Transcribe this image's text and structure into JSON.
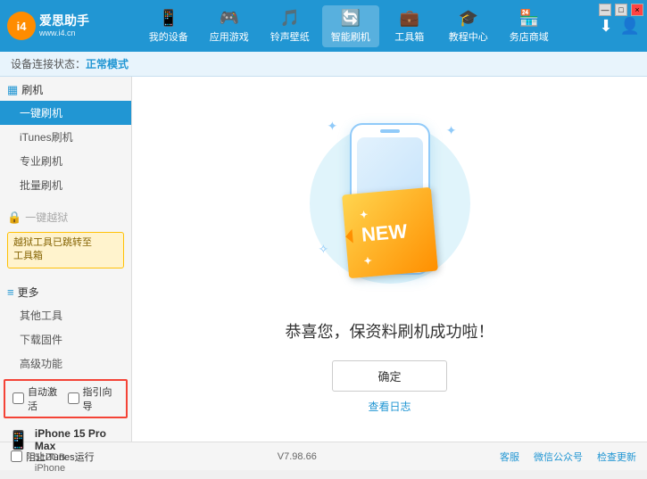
{
  "app": {
    "logo_text_main": "爱思助手",
    "logo_text_sub": "www.i4.cn",
    "logo_abbr": "i4"
  },
  "nav": {
    "items": [
      {
        "id": "my-device",
        "icon": "📱",
        "label": "我的设备"
      },
      {
        "id": "apps-games",
        "icon": "👤",
        "label": "应用游戏"
      },
      {
        "id": "ringtone",
        "icon": "🎵",
        "label": "铃声壁纸"
      },
      {
        "id": "smart-flash",
        "icon": "🔄",
        "label": "智能刷机",
        "active": true
      },
      {
        "id": "toolbox",
        "icon": "💼",
        "label": "工具箱"
      },
      {
        "id": "tutorial",
        "icon": "🎓",
        "label": "教程中心"
      },
      {
        "id": "service",
        "icon": "🏪",
        "label": "务店商域"
      }
    ],
    "right_download": "⬇",
    "right_user": "👤"
  },
  "statusbar": {
    "prefix": "设备连接状态：",
    "mode": "正常模式"
  },
  "sidebar": {
    "flash_section": "刷机",
    "items": [
      {
        "id": "one-click-flash",
        "label": "一键刷机",
        "active": true
      },
      {
        "id": "itunes-flash",
        "label": "iTunes刷机"
      },
      {
        "id": "pro-flash",
        "label": "专业刷机"
      },
      {
        "id": "batch-flash",
        "label": "批量刷机"
      }
    ],
    "disabled_section": "一键越狱",
    "warning_text": "越狱工具已跳转至\n工具箱",
    "more_section": "更多",
    "more_items": [
      {
        "id": "other-tools",
        "label": "其他工具"
      },
      {
        "id": "download-firmware",
        "label": "下载固件"
      },
      {
        "id": "advanced",
        "label": "高级功能"
      }
    ],
    "auto_activate": "自动激活",
    "guide_import": "指引向导",
    "device_name": "iPhone 15 Pro Max",
    "device_storage": "512GB",
    "device_type": "iPhone",
    "itunes_label": "阻止iTunes运行"
  },
  "content": {
    "new_badge": "NEW",
    "new_stars": "✦",
    "success_text": "恭喜您，保资料刷机成功啦！",
    "confirm_button": "确定",
    "view_log": "查看日志"
  },
  "bottombar": {
    "itunes_label": "阻止iTunes运行",
    "version": "V7.98.66",
    "links": [
      "客服",
      "微信公众号",
      "检查更新"
    ]
  },
  "window_controls": [
    "—",
    "□",
    "×"
  ]
}
